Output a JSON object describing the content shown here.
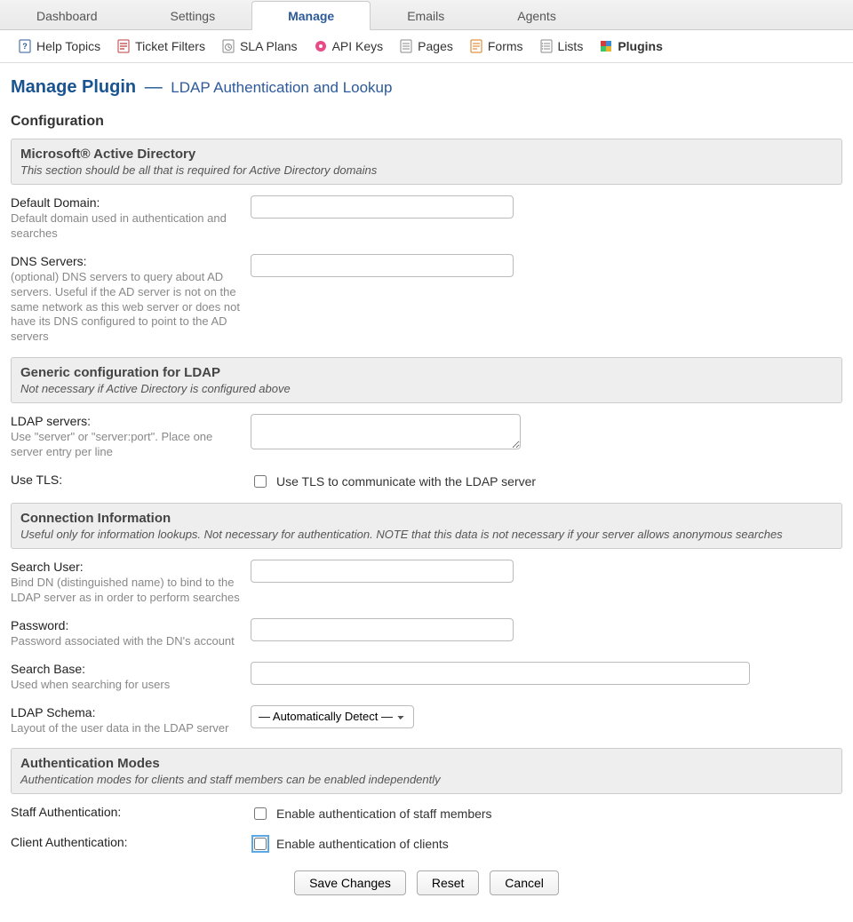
{
  "top_tabs": {
    "dashboard": "Dashboard",
    "settings": "Settings",
    "manage": "Manage",
    "emails": "Emails",
    "agents": "Agents"
  },
  "sub_nav": {
    "help_topics": "Help Topics",
    "ticket_filters": "Ticket Filters",
    "sla_plans": "SLA Plans",
    "api_keys": "API Keys",
    "pages": "Pages",
    "forms": "Forms",
    "lists": "Lists",
    "plugins": "Plugins"
  },
  "page": {
    "title_main": "Manage Plugin",
    "title_sep": "—",
    "title_sub": "LDAP Authentication and Lookup",
    "config_heading": "Configuration"
  },
  "sections": {
    "ad": {
      "title": "Microsoft® Active Directory",
      "subtitle": "This section should be all that is required for Active Directory domains"
    },
    "ldap": {
      "title": "Generic configuration for LDAP",
      "subtitle": "Not necessary if Active Directory is configured above"
    },
    "conn": {
      "title": "Connection Information",
      "subtitle": "Useful only for information lookups. Not necessary for authentication. NOTE that this data is not necessary if your server allows anonymous searches"
    },
    "auth": {
      "title": "Authentication Modes",
      "subtitle": "Authentication modes for clients and staff members can be enabled independently"
    }
  },
  "fields": {
    "default_domain": {
      "label": "Default Domain:",
      "help": "Default domain used in authentication and searches",
      "value": ""
    },
    "dns_servers": {
      "label": "DNS Servers:",
      "help": "(optional) DNS servers to query about AD servers. Useful if the AD server is not on the same network as this web server or does not have its DNS configured to point to the AD servers",
      "value": ""
    },
    "ldap_servers": {
      "label": "LDAP servers:",
      "help": "Use \"server\" or \"server:port\". Place one server entry per line",
      "value": ""
    },
    "use_tls": {
      "label": "Use TLS:",
      "chk_label": "Use TLS to communicate with the LDAP server",
      "checked": false
    },
    "search_user": {
      "label": "Search User:",
      "help": "Bind DN (distinguished name) to bind to the LDAP server as in order to perform searches",
      "value": ""
    },
    "password": {
      "label": "Password:",
      "help": "Password associated with the DN's account",
      "value": ""
    },
    "search_base": {
      "label": "Search Base:",
      "help": "Used when searching for users",
      "value": ""
    },
    "ldap_schema": {
      "label": "LDAP Schema:",
      "help": "Layout of the user data in the LDAP server",
      "selected": "— Automatically Detect —"
    },
    "staff_auth": {
      "label": "Staff Authentication:",
      "chk_label": "Enable authentication of staff members",
      "checked": false
    },
    "client_auth": {
      "label": "Client Authentication:",
      "chk_label": "Enable authentication of clients",
      "checked": false
    }
  },
  "buttons": {
    "save": "Save Changes",
    "reset": "Reset",
    "cancel": "Cancel"
  }
}
